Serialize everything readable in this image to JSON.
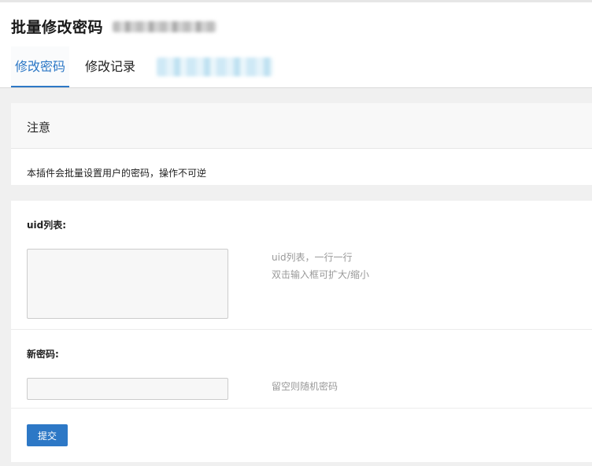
{
  "header": {
    "title": "批量修改密码",
    "tabs": [
      {
        "label": "修改密码",
        "active": true
      },
      {
        "label": "修改记录",
        "active": false
      }
    ]
  },
  "notice": {
    "title": "注意",
    "text": "本插件会批量设置用户的密码，操作不可逆"
  },
  "form": {
    "uid_label": "uid列表:",
    "uid_hint_line1": "uid列表，一行一行",
    "uid_hint_line2": "双击输入框可扩大/缩小",
    "uid_value": "",
    "password_label": "新密码:",
    "password_hint": "留空则随机密码",
    "password_value": "",
    "submit_label": "提交"
  },
  "colors": {
    "accent": "#2d78c6",
    "hint_text": "#999999",
    "background": "#f0f0f0"
  }
}
